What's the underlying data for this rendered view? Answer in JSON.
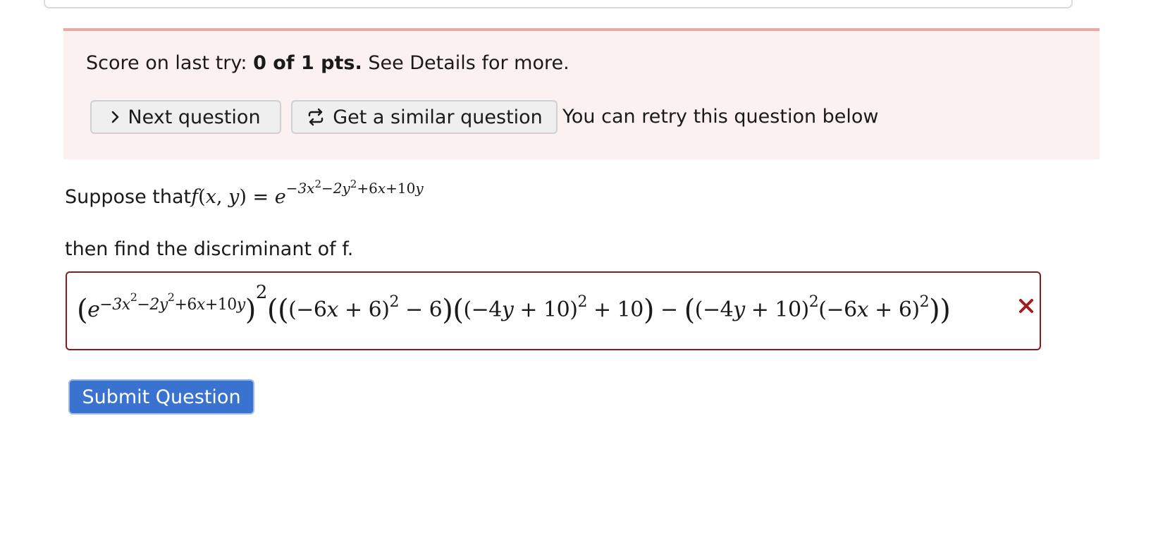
{
  "score": {
    "prefix": "Score on last try: ",
    "value": "0 of 1 pts.",
    "suffix": " See Details for more."
  },
  "buttons": {
    "next_label": "Next question",
    "similar_label": "Get a similar question",
    "submit_label": "Submit Question"
  },
  "retry_text": "You can retry this question below",
  "question": {
    "prefix": "Suppose that ",
    "then_text": "then find the discriminant of f."
  },
  "icons": {
    "next": "chevron-right-icon",
    "similar": "repeat-arrows-icon",
    "incorrect": "x-mark-icon"
  },
  "colors": {
    "banner_bg": "#fcf1f1",
    "banner_border": "#eca8a2",
    "answer_border": "#8b1a1a",
    "incorrect_mark": "#a11d1d",
    "submit_bg": "#3a72d0"
  }
}
